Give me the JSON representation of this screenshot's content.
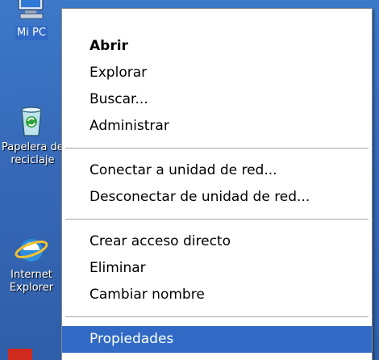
{
  "desktop": {
    "icons": [
      {
        "name": "my-pc",
        "label": "Mi PC"
      },
      {
        "name": "recycle-bin",
        "label": "Papelera de\nreciclaje"
      },
      {
        "name": "internet-explorer",
        "label": "Internet\nExplorer"
      }
    ]
  },
  "context_menu": {
    "items": [
      {
        "label": "Abrir"
      },
      {
        "label": "Explorar"
      },
      {
        "label": "Buscar..."
      },
      {
        "label": "Administrar"
      },
      {
        "label": "Conectar a unidad de red..."
      },
      {
        "label": "Desconectar de unidad de red..."
      },
      {
        "label": "Crear acceso directo"
      },
      {
        "label": "Eliminar"
      },
      {
        "label": "Cambiar nombre"
      },
      {
        "label": "Propiedades"
      }
    ]
  },
  "colors": {
    "desktop": "#3a6ea5",
    "highlight": "#316ac5",
    "menu_bg": "#ffffff"
  }
}
